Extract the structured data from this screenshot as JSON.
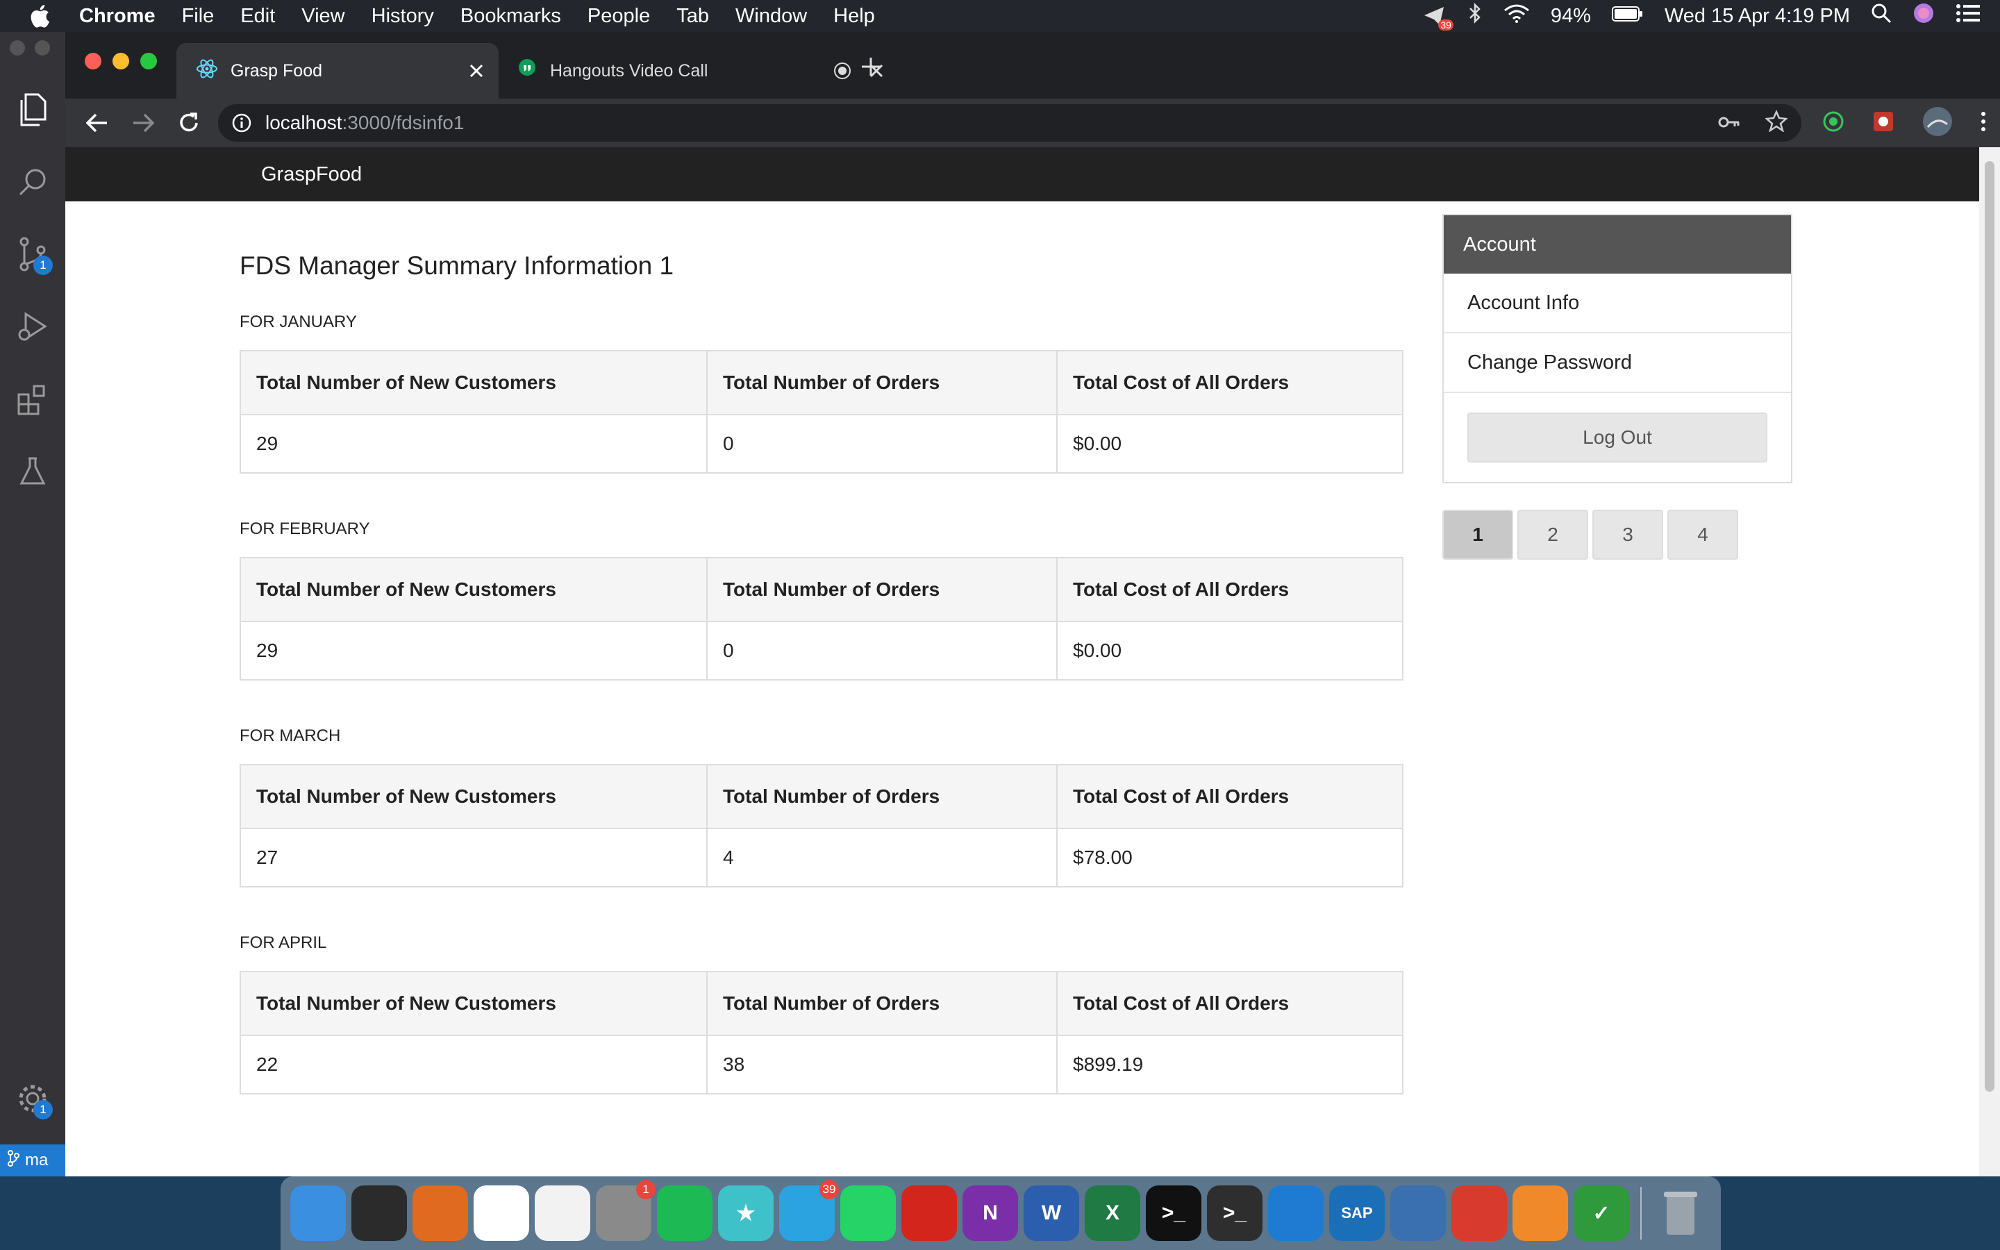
{
  "menubar": {
    "app_name": "Chrome",
    "items": [
      "File",
      "Edit",
      "View",
      "History",
      "Bookmarks",
      "People",
      "Tab",
      "Window",
      "Help"
    ],
    "notification_count": "39",
    "battery": "94%",
    "datetime": "Wed 15 Apr  4:19 PM"
  },
  "vscode": {
    "scm_badge": "1",
    "settings_badge": "1",
    "branch": "ma"
  },
  "browser": {
    "tabs": [
      {
        "title": "Grasp Food",
        "icon": "react-icon",
        "active": true
      },
      {
        "title": "Hangouts Video Call",
        "icon": "hangouts-icon",
        "active": false
      }
    ],
    "url_host": "localhost",
    "url_path": ":3000/fdsinfo1"
  },
  "site": {
    "brand": "GraspFood",
    "title": "FDS Manager Summary Information 1",
    "columns": [
      "Total Number of New Customers",
      "Total Number of Orders",
      "Total Cost of All Orders"
    ],
    "months": [
      {
        "label": "FOR JANUARY",
        "new_customers": "29",
        "orders": "0",
        "cost": "$0.00"
      },
      {
        "label": "FOR FEBRUARY",
        "new_customers": "29",
        "orders": "0",
        "cost": "$0.00"
      },
      {
        "label": "FOR MARCH",
        "new_customers": "27",
        "orders": "4",
        "cost": "$78.00"
      },
      {
        "label": "FOR APRIL",
        "new_customers": "22",
        "orders": "38",
        "cost": "$899.19"
      }
    ],
    "sidebar": {
      "heading": "Account",
      "items": [
        "Account Info",
        "Change Password"
      ],
      "logout": "Log Out"
    },
    "pagination": [
      "1",
      "2",
      "3",
      "4"
    ],
    "active_page": "1"
  },
  "dock": {
    "apps": [
      {
        "name": "finder-icon",
        "color": "#3b8fe0",
        "glyph": ""
      },
      {
        "name": "activity-monitor-icon",
        "color": "#2b2b2b",
        "glyph": ""
      },
      {
        "name": "firefox-icon",
        "color": "#e06a1f",
        "glyph": ""
      },
      {
        "name": "chrome-icon",
        "color": "#ffffff",
        "glyph": ""
      },
      {
        "name": "textedit-icon",
        "color": "#f2f2f2",
        "glyph": ""
      },
      {
        "name": "system-preferences-icon",
        "color": "#8a8a8a",
        "glyph": "",
        "badge": "1"
      },
      {
        "name": "spotify-icon",
        "color": "#1db954",
        "glyph": ""
      },
      {
        "name": "superstar-icon",
        "color": "#3fc1c9",
        "glyph": "★"
      },
      {
        "name": "telegram-icon",
        "color": "#2aa3e0",
        "glyph": "",
        "badge": "39"
      },
      {
        "name": "whatsapp-icon",
        "color": "#25d366",
        "glyph": ""
      },
      {
        "name": "acrobat-icon",
        "color": "#d4251c",
        "glyph": ""
      },
      {
        "name": "onenote-icon",
        "color": "#7a2fa8",
        "glyph": "N"
      },
      {
        "name": "word-icon",
        "color": "#2b5fad",
        "glyph": "W"
      },
      {
        "name": "excel-icon",
        "color": "#1f7a44",
        "glyph": "X"
      },
      {
        "name": "terminal-icon",
        "color": "#111111",
        "glyph": ">_"
      },
      {
        "name": "terminal-alt-icon",
        "color": "#2e2e2e",
        "glyph": ">_"
      },
      {
        "name": "vscode-icon",
        "color": "#1f7ad1",
        "glyph": ""
      },
      {
        "name": "sap-icon",
        "color": "#1b6fb8",
        "glyph": "SAP"
      },
      {
        "name": "virtualbox-icon",
        "color": "#3a6fb0",
        "glyph": ""
      },
      {
        "name": "git-client-icon",
        "color": "#d83a2e",
        "glyph": ""
      },
      {
        "name": "sublime-icon",
        "color": "#f0892a",
        "glyph": ""
      },
      {
        "name": "vim-icon",
        "color": "#2e9a3c",
        "glyph": "✓"
      }
    ]
  }
}
